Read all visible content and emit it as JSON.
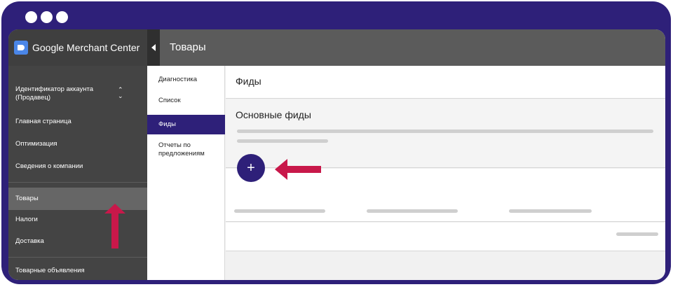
{
  "app": {
    "name": "Google Merchant Center",
    "page_title": "Товары"
  },
  "sidebar": {
    "account_label": "Идентификатор аккаунта (Продавец)",
    "items": [
      {
        "label": "Главная страница"
      },
      {
        "label": "Оптимизация"
      },
      {
        "label": "Сведения о компании"
      },
      {
        "label": "Товары",
        "active": true
      },
      {
        "label": "Налоги"
      },
      {
        "label": "Доставка"
      },
      {
        "label": "Товарные объявления"
      }
    ]
  },
  "subnav": {
    "items": [
      {
        "label": "Диагностика"
      },
      {
        "label": "Список"
      },
      {
        "label": "Фиды",
        "active": true
      },
      {
        "label": "Отчеты по предложениям"
      }
    ]
  },
  "main": {
    "header_title": "Фиды",
    "section_title": "Основные фиды",
    "add_button_label": "+"
  },
  "icons": {
    "brand": "merchant-tag-icon",
    "collapse": "triangle-left-icon",
    "account_switch": "chevron-up-down-icon",
    "annotation_up": "red-arrow-up-icon",
    "annotation_left": "red-arrow-left-icon"
  },
  "colors": {
    "frame": "#2e2079",
    "accent": "#2e2079",
    "annotation_arrow": "#c8184a",
    "sidebar_bg": "#444444",
    "topbar_bg": "#5b5b5b"
  }
}
